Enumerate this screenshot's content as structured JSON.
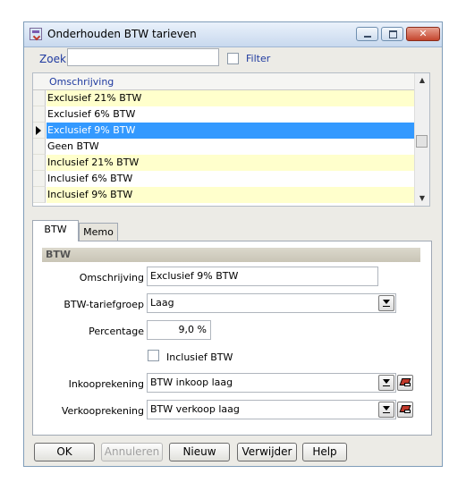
{
  "window": {
    "title": "Onderhouden BTW tarieven"
  },
  "search": {
    "label": "Zoek",
    "value": "",
    "filter_label": "Filter",
    "filter_checked": false
  },
  "grid": {
    "column": "Omschrijving",
    "rows": [
      {
        "text": "Exclusief 21% BTW",
        "style": "yellow"
      },
      {
        "text": "Exclusief 6% BTW",
        "style": "white"
      },
      {
        "text": "Exclusief 9% BTW",
        "style": "selected"
      },
      {
        "text": "Geen BTW",
        "style": "white"
      },
      {
        "text": "Inclusief 21% BTW",
        "style": "yellow"
      },
      {
        "text": "Inclusief 6% BTW",
        "style": "white"
      },
      {
        "text": "Inclusief 9% BTW",
        "style": "yellow"
      }
    ]
  },
  "tabs": {
    "active": "BTW",
    "inactive": "Memo"
  },
  "section": {
    "title": "BTW"
  },
  "form": {
    "omschrijving_label": "Omschrijving",
    "omschrijving_value": "Exclusief 9% BTW",
    "tariefgroep_label": "BTW-tariefgroep",
    "tariefgroep_value": "Laag",
    "percentage_label": "Percentage",
    "percentage_value": "9,0 %",
    "inclusief_label": "Inclusief BTW",
    "inclusief_checked": false,
    "inkoop_label": "Inkooprekening",
    "inkoop_value": "BTW inkoop laag",
    "verkoop_label": "Verkooprekening",
    "verkoop_value": "BTW verkoop laag"
  },
  "buttons": {
    "ok": "OK",
    "annuleren": "Annuleren",
    "nieuw": "Nieuw",
    "verwijder": "Verwijder",
    "help": "Help"
  },
  "colors": {
    "selected_row": "#3399ff",
    "yellow_row": "#ffffcc",
    "label_blue": "#1f3aa0"
  }
}
